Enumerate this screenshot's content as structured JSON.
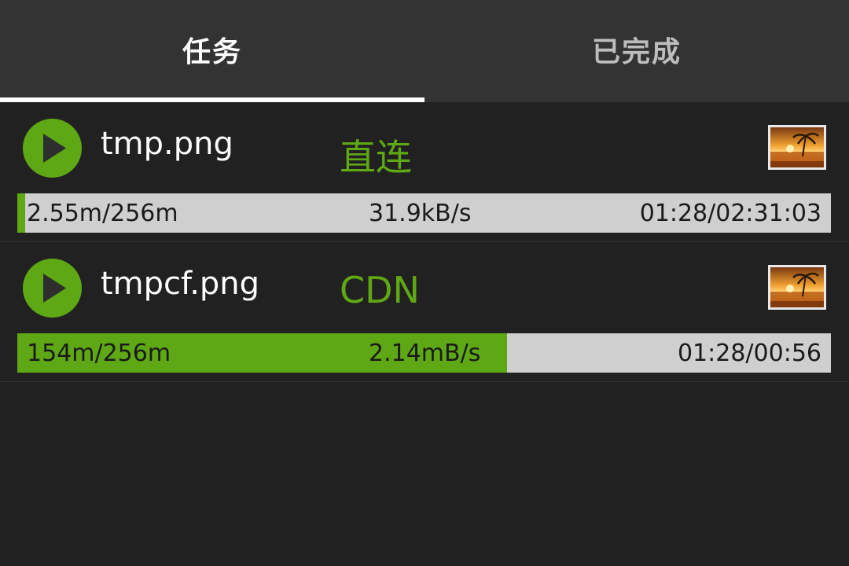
{
  "tabs": [
    {
      "label": "任务",
      "active": true
    },
    {
      "label": "已完成",
      "active": false
    }
  ],
  "colors": {
    "accent": "#5fa815",
    "background": "#212121",
    "tabbar": "#333333",
    "progress_track": "#cfcfcf"
  },
  "tasks": [
    {
      "filename": "tmp.png",
      "route": "直连",
      "progress_fraction": 0.00996,
      "size_text": "2.55m/256m",
      "speed_text": "31.9kB/s",
      "time_text": "01:28/02:31:03",
      "icon": "play-icon",
      "thumbnail": "image-thumbnail-icon"
    },
    {
      "filename": "tmpcf.png",
      "route": "CDN",
      "progress_fraction": 0.6016,
      "size_text": "154m/256m",
      "speed_text": "2.14mB/s",
      "time_text": "01:28/00:56",
      "icon": "play-icon",
      "thumbnail": "image-thumbnail-icon"
    }
  ]
}
